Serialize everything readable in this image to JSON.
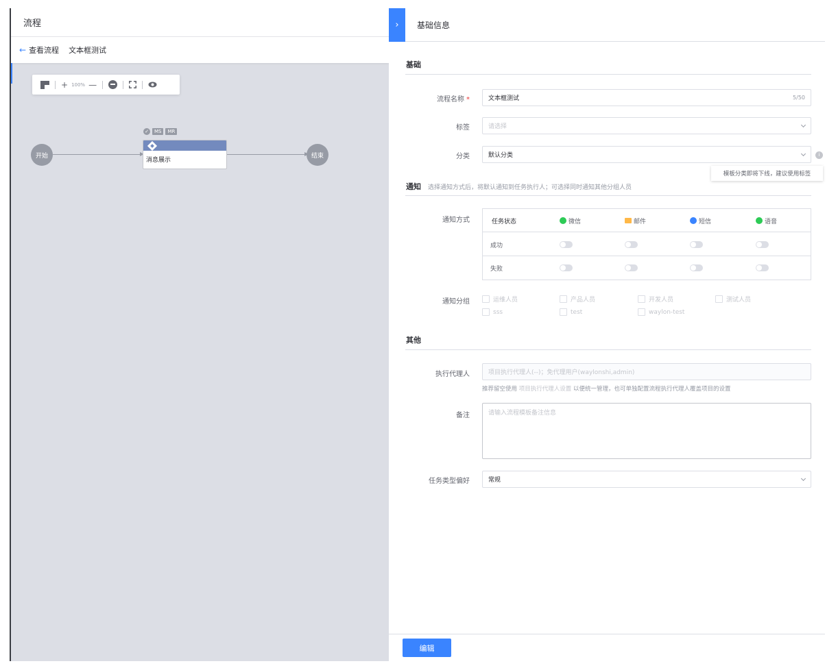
{
  "left": {
    "title": "流程",
    "back_label": "查看流程",
    "flow_name": "文本框测试",
    "toolbar": {
      "zoom": "100%"
    },
    "canvas": {
      "start_label": "开始",
      "end_label": "结束",
      "task_tags": [
        "MS",
        "MR"
      ],
      "task_label": "消息展示"
    }
  },
  "panel": {
    "title": "基础信息",
    "sections": {
      "basic": "基础",
      "notify": "通知",
      "notify_desc": "选择通知方式后，将默认通知到任务执行人；可选择同时通知其他分组人员",
      "other": "其他"
    },
    "fields": {
      "name_label": "流程名称",
      "name_value": "文本框测试",
      "name_count": "5/50",
      "tag_label": "标签",
      "tag_placeholder": "请选择",
      "category_label": "分类",
      "category_value": "默认分类",
      "category_tooltip": "模板分类即将下线，建议使用标签",
      "notify_type_label": "通知方式",
      "notify_group_label": "通知分组",
      "executor_label": "执行代理人",
      "executor_placeholder": "项目执行代理人(--)；免代理用户(waylonshi,admin)",
      "executor_hint_prefix": "推荐留空使用",
      "executor_hint_link": "项目执行代理人设置",
      "executor_hint_suffix": "以便统一管理，也可单独配置流程执行代理人覆盖项目的设置",
      "remark_label": "备注",
      "remark_placeholder": "请输入流程模板备注信息",
      "task_type_label": "任务类型偏好",
      "task_type_value": "常规"
    },
    "notify_table": {
      "header": "任务状态",
      "channels": [
        {
          "name": "微信",
          "color": "#2dcb56"
        },
        {
          "name": "邮件",
          "color": "#ffb848"
        },
        {
          "name": "短信",
          "color": "#3a84ff"
        },
        {
          "name": "语音",
          "color": "#2dcb56"
        }
      ],
      "rows": [
        "成功",
        "失败"
      ]
    },
    "groups": [
      "运维人员",
      "产品人员",
      "开发人员",
      "测试人员",
      "sss",
      "test",
      "waylon-test"
    ],
    "edit_button": "编辑"
  }
}
